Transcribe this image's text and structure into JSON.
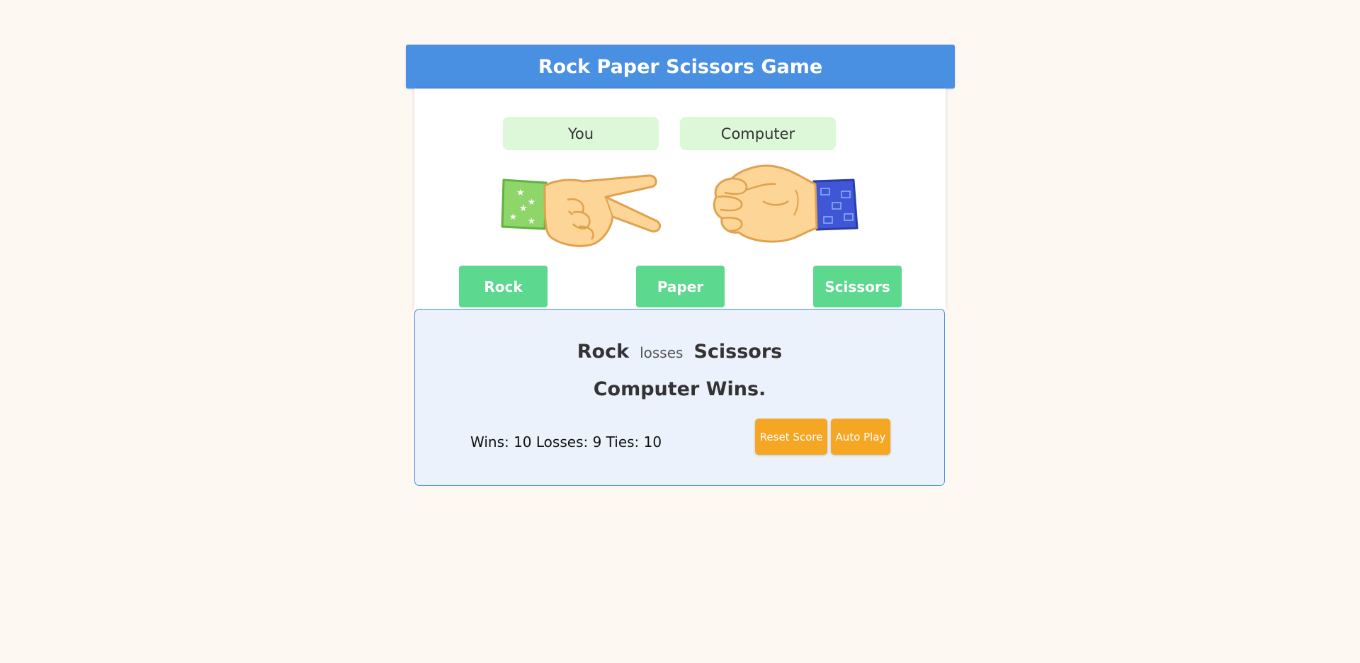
{
  "header": {
    "title": "Rock Paper Scissors Game"
  },
  "players": {
    "you": "You",
    "computer": "Computer"
  },
  "hands": {
    "player_move": "scissors-hand-icon",
    "computer_move": "fist-hand-icon"
  },
  "moves": {
    "rock": "Rock",
    "paper": "Paper",
    "scissors": "Scissors"
  },
  "result": {
    "player_move": "Rock",
    "verb": "losses",
    "computer_move": "Scissors",
    "outcome": "Computer Wins.",
    "score": "Wins: 10 Losses: 9 Ties: 10"
  },
  "actions": {
    "reset": "Reset Score",
    "auto_play": "Auto Play"
  },
  "colors": {
    "header": "#4a90e2",
    "label_bg": "#dcf8d8",
    "move_button": "#5cd98f",
    "action_button": "#f5a623",
    "result_bg": "#ebf2fb"
  }
}
